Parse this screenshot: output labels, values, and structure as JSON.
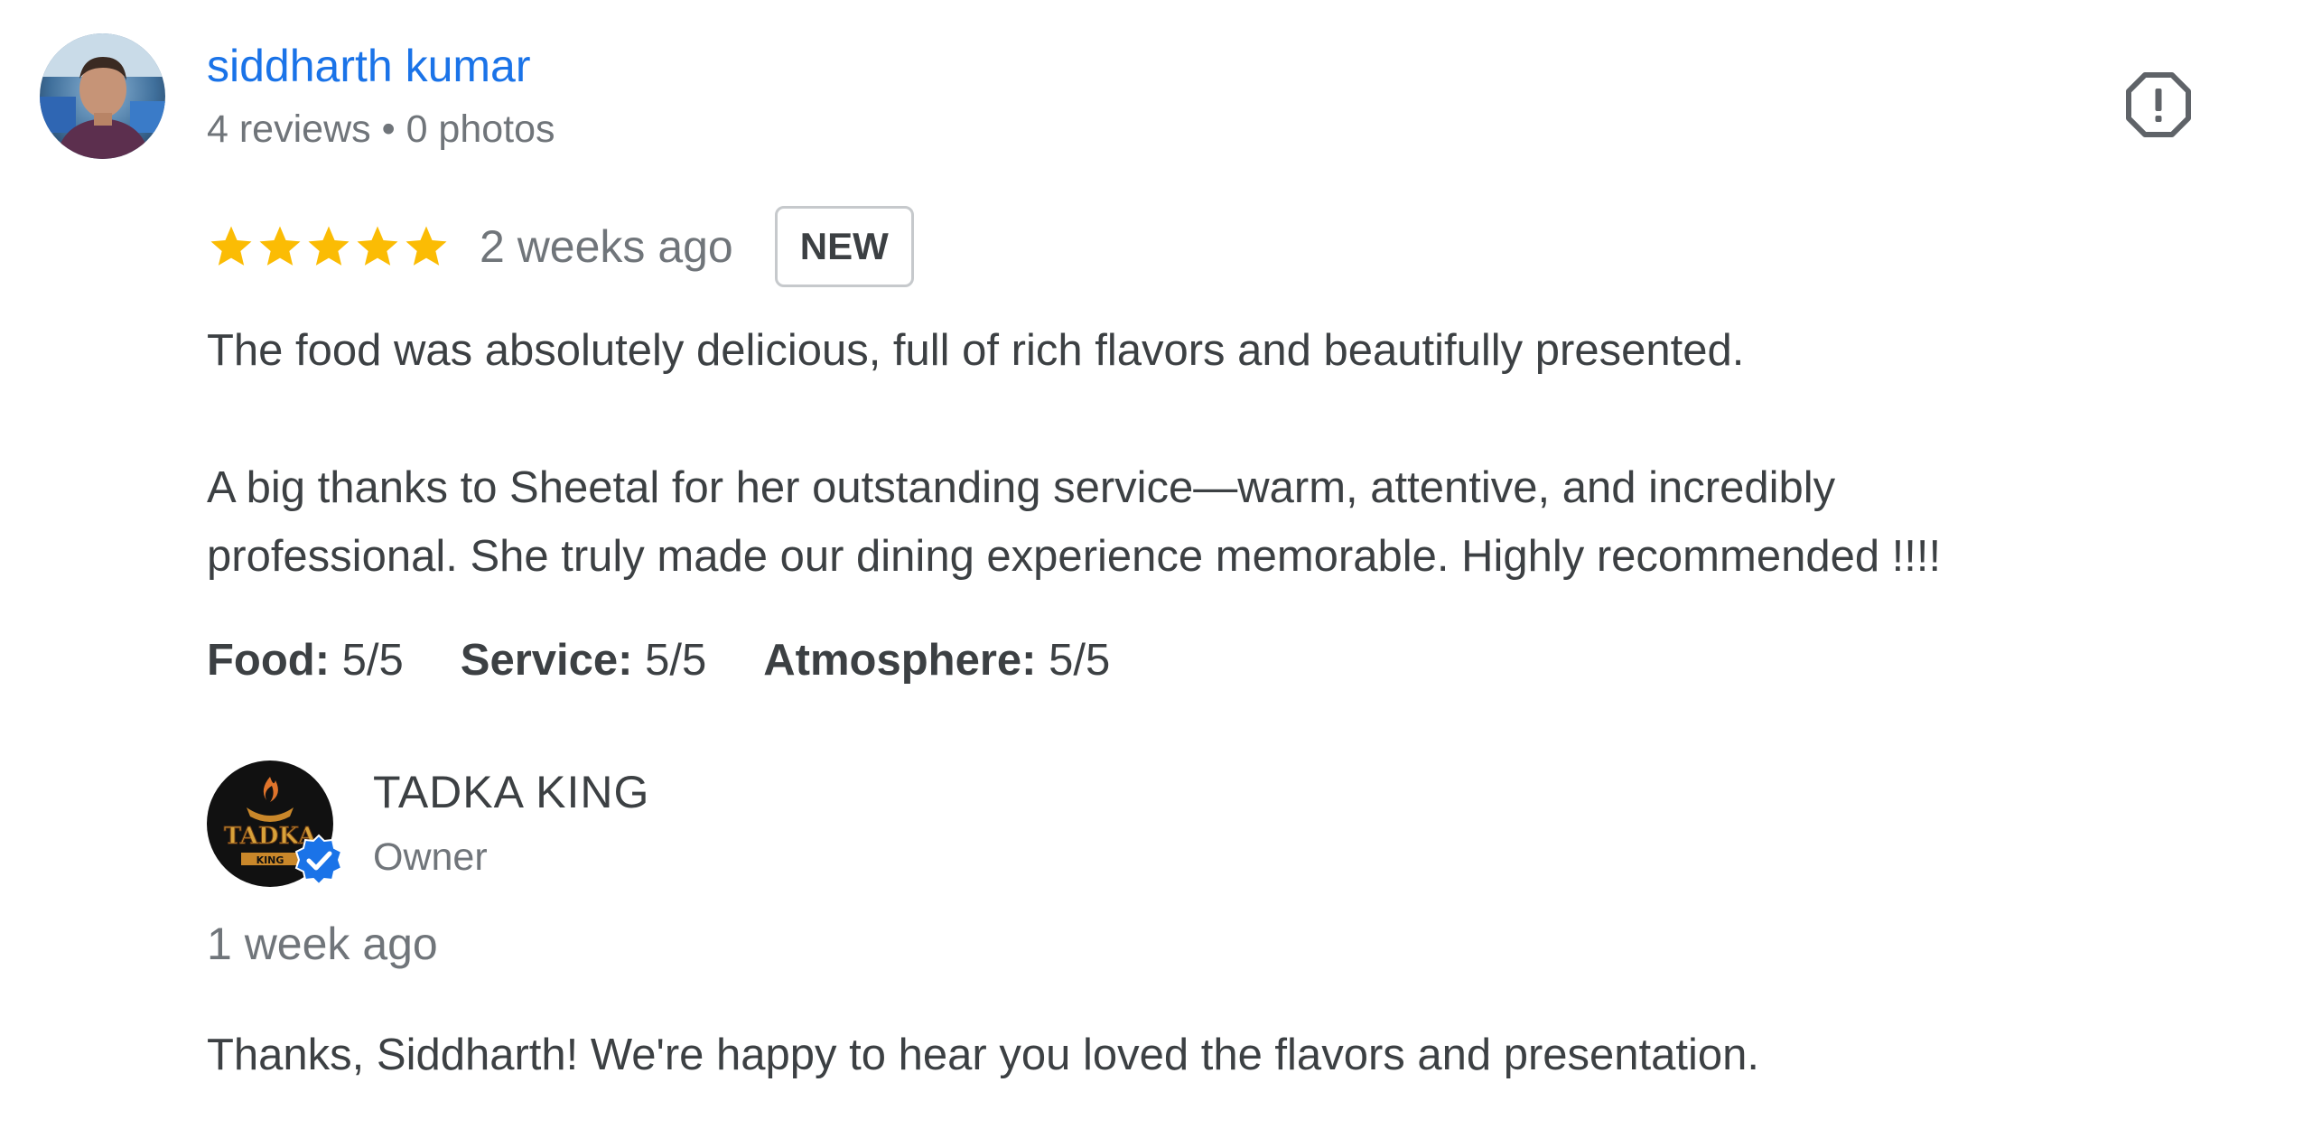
{
  "review": {
    "reviewer": {
      "name": "siddharth kumar",
      "meta": "4 reviews • 0 photos",
      "avatar_icon": "user-photo-avatar"
    },
    "report_icon": "report-octagon-icon",
    "rating": 5,
    "max_rating": 5,
    "star_color": "#fbbc04",
    "time_ago": "2 weeks ago",
    "badge": "NEW",
    "text_paragraphs": [
      "The food was absolutely delicious, full of rich flavors and beautifully presented.",
      "A big thanks to Sheetal for her outstanding service—warm, attentive, and incredibly",
      "professional. She truly made our dining experience memorable. Highly recommended !!!!"
    ],
    "sub_ratings": [
      {
        "label": "Food:",
        "value": "5/5"
      },
      {
        "label": "Service:",
        "value": "5/5"
      },
      {
        "label": "Atmosphere:",
        "value": "5/5"
      }
    ]
  },
  "owner_reply": {
    "name": "TADKA KING",
    "role": "Owner",
    "logo_icon": "restaurant-logo",
    "logo_text": "TADKA",
    "logo_subtext": "KING",
    "verified_icon": "verified-badge-icon",
    "time_ago": "1 week ago",
    "text": "Thanks, Siddharth! We're happy to hear you loved the flavors and presentation."
  },
  "colors": {
    "link_blue": "#1a73e8",
    "text_dark": "#3c4043",
    "text_grey": "#70757a",
    "star_yellow": "#fbbc04",
    "verified_blue": "#1a73e8"
  }
}
